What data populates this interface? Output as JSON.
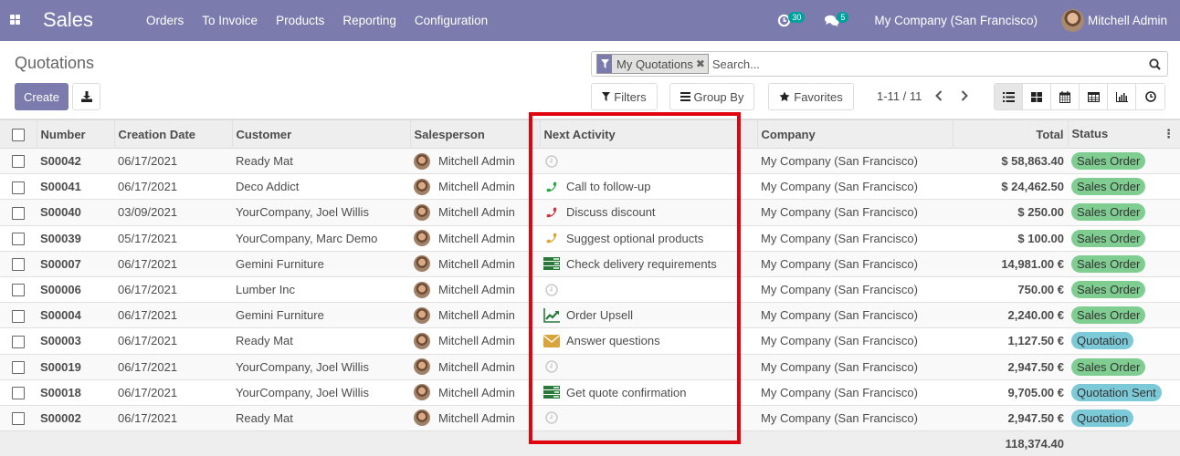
{
  "navbar": {
    "app_name": "Sales",
    "menu": [
      "Orders",
      "To Invoice",
      "Products",
      "Reporting",
      "Configuration"
    ],
    "activity_count": "30",
    "message_count": "5",
    "company": "My Company (San Francisco)",
    "user": "Mitchell Admin",
    "bg_color": "#7c7bad"
  },
  "control_panel": {
    "breadcrumb": "Quotations",
    "create_label": "Create",
    "search": {
      "facet_label": "My Quotations",
      "placeholder": "Search..."
    },
    "filters_label": "Filters",
    "group_by_label": "Group By",
    "favorites_label": "Favorites",
    "pager": "1-11 / 11",
    "views": [
      "list",
      "kanban",
      "calendar",
      "pivot",
      "graph",
      "activity"
    ],
    "active_view": "list"
  },
  "table": {
    "columns": [
      "Number",
      "Creation Date",
      "Customer",
      "Salesperson",
      "Next Activity",
      "Company",
      "Total",
      "Status"
    ],
    "rows": [
      {
        "number": "S00042",
        "date": "06/17/2021",
        "customer": "Ready Mat",
        "salesperson": "Mitchell Admin",
        "activity": "",
        "activity_icon": "clock",
        "company": "My Company (San Francisco)",
        "total": "$ 58,863.40",
        "status": "Sales Order",
        "status_color": "green"
      },
      {
        "number": "S00041",
        "date": "06/17/2021",
        "customer": "Deco Addict",
        "salesperson": "Mitchell Admin",
        "activity": "Call to follow-up",
        "activity_icon": "phone-green",
        "company": "My Company (San Francisco)",
        "total": "$ 24,462.50",
        "status": "Sales Order",
        "status_color": "green"
      },
      {
        "number": "S00040",
        "date": "03/09/2021",
        "customer": "YourCompany, Joel Willis",
        "salesperson": "Mitchell Admin",
        "activity": "Discuss discount",
        "activity_icon": "phone-red",
        "company": "My Company (San Francisco)",
        "total": "$ 250.00",
        "status": "Sales Order",
        "status_color": "green"
      },
      {
        "number": "S00039",
        "date": "05/17/2021",
        "customer": "YourCompany, Marc Demo",
        "salesperson": "Mitchell Admin",
        "activity": "Suggest optional products",
        "activity_icon": "phone-orange",
        "company": "My Company (San Francisco)",
        "total": "$ 100.00",
        "status": "Sales Order",
        "status_color": "green"
      },
      {
        "number": "S00007",
        "date": "06/17/2021",
        "customer": "Gemini Furniture",
        "salesperson": "Mitchell Admin",
        "activity": "Check delivery requirements",
        "activity_icon": "tasks",
        "company": "My Company (San Francisco)",
        "total": "14,981.00 €",
        "status": "Sales Order",
        "status_color": "green"
      },
      {
        "number": "S00006",
        "date": "06/17/2021",
        "customer": "Lumber Inc",
        "salesperson": "Mitchell Admin",
        "activity": "",
        "activity_icon": "clock",
        "company": "My Company (San Francisco)",
        "total": "750.00 €",
        "status": "Sales Order",
        "status_color": "green"
      },
      {
        "number": "S00004",
        "date": "06/17/2021",
        "customer": "Gemini Furniture",
        "salesperson": "Mitchell Admin",
        "activity": "Order Upsell",
        "activity_icon": "chart",
        "company": "My Company (San Francisco)",
        "total": "2,240.00 €",
        "status": "Sales Order",
        "status_color": "green"
      },
      {
        "number": "S00003",
        "date": "06/17/2021",
        "customer": "Ready Mat",
        "salesperson": "Mitchell Admin",
        "activity": "Answer questions",
        "activity_icon": "envelope",
        "company": "My Company (San Francisco)",
        "total": "1,127.50 €",
        "status": "Quotation",
        "status_color": "blue"
      },
      {
        "number": "S00019",
        "date": "06/17/2021",
        "customer": "YourCompany, Joel Willis",
        "salesperson": "Mitchell Admin",
        "activity": "",
        "activity_icon": "clock",
        "company": "My Company (San Francisco)",
        "total": "2,947.50 €",
        "status": "Sales Order",
        "status_color": "green"
      },
      {
        "number": "S00018",
        "date": "06/17/2021",
        "customer": "YourCompany, Joel Willis",
        "salesperson": "Mitchell Admin",
        "activity": "Get quote confirmation",
        "activity_icon": "tasks",
        "company": "My Company (San Francisco)",
        "total": "9,705.00 €",
        "status": "Quotation Sent",
        "status_color": "blue"
      },
      {
        "number": "S00002",
        "date": "06/17/2021",
        "customer": "Ready Mat",
        "salesperson": "Mitchell Admin",
        "activity": "",
        "activity_icon": "clock",
        "company": "My Company (San Francisco)",
        "total": "2,947.50 €",
        "status": "Quotation",
        "status_color": "blue"
      }
    ],
    "footer_total": "118,374.40"
  },
  "colors": {
    "primary": "#7c7bad",
    "highlight_border": "#e2040c",
    "status_green": "#7fcd91",
    "status_blue": "#7cc9d7"
  }
}
